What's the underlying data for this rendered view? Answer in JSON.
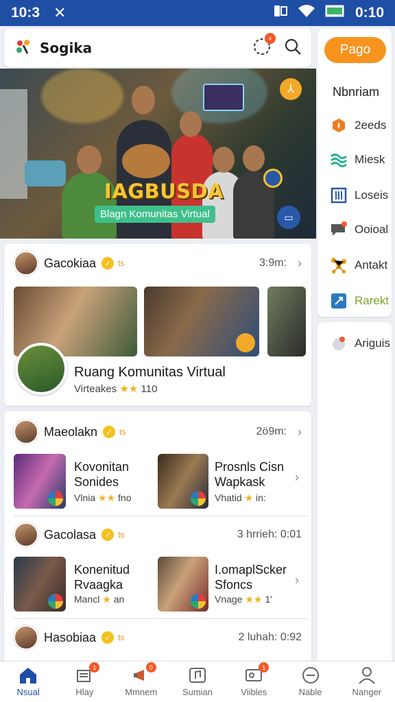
{
  "status": {
    "time_left": "10:3",
    "time_right": "0:10"
  },
  "app": {
    "brand": "Sogika",
    "notif_badge": "x"
  },
  "hero": {
    "title": "IAGBUSDA",
    "subtitle": "Blagn Komunitas Virtual"
  },
  "side": {
    "pago": "Pago",
    "heading": "Nbnriam",
    "items": [
      {
        "label": "2eeds",
        "icon": "fire-icon",
        "color": "#f07b1d"
      },
      {
        "label": "Miesk",
        "icon": "waves-icon",
        "color": "#2bb391"
      },
      {
        "label": "Loseis",
        "icon": "grid-icon",
        "color": "#2a58a8"
      },
      {
        "label": "Ooioal",
        "icon": "chat-icon",
        "color": "#555555"
      },
      {
        "label": "Antakt",
        "icon": "network-icon",
        "color": "#e8a21a"
      },
      {
        "label": "Rarekt",
        "icon": "link-icon",
        "color": "#2a7ac0"
      }
    ],
    "extra_label": "Ariguis"
  },
  "feed": {
    "post1": {
      "user": "Gacokiaa",
      "tag": "ts",
      "time": "3:9m:",
      "community_title": "Ruang Komunitas Virtual",
      "community_meta": "Virteakes",
      "community_rating": "110"
    },
    "post2": {
      "user": "Maeolakn",
      "tag": "ts",
      "time": "2ö9m:",
      "items": [
        {
          "title": "Kovonitan Sonides",
          "meta_left": "Vlnia",
          "meta_right": "fno"
        },
        {
          "title": "Prosnls Cisn Wapkask",
          "meta_left": "Vhatid",
          "meta_right": "in:"
        }
      ]
    },
    "post3": {
      "user": "Gacolasa",
      "tag": "ts",
      "time": "3 hrrieh: 0:01",
      "items": [
        {
          "title": "Konenitud Rvaagka",
          "meta_left": "Mancl",
          "meta_right": "an"
        },
        {
          "title": "I.omaplScker Sfoncs",
          "meta_left": "Vnage",
          "meta_right": "1'"
        }
      ]
    },
    "post4": {
      "user": "Hasobiaa",
      "tag": "ts",
      "time": "2 luhah: 0:92"
    }
  },
  "nav": [
    {
      "label": "Nsual",
      "icon": "home-icon",
      "badge": "",
      "active": true
    },
    {
      "label": "Hlay",
      "icon": "layers-icon",
      "badge": "1",
      "active": false
    },
    {
      "label": "Mmnem",
      "icon": "megaphone-icon",
      "badge": "0",
      "active": false
    },
    {
      "label": "Sumian",
      "icon": "music-icon",
      "badge": "",
      "active": false
    },
    {
      "label": "Viibles",
      "icon": "gallery-icon",
      "badge": "1",
      "active": false
    },
    {
      "label": "Nable",
      "icon": "minus-circle-icon",
      "badge": "",
      "active": false
    },
    {
      "label": "Nanger",
      "icon": "person-icon",
      "badge": "",
      "active": false
    }
  ]
}
